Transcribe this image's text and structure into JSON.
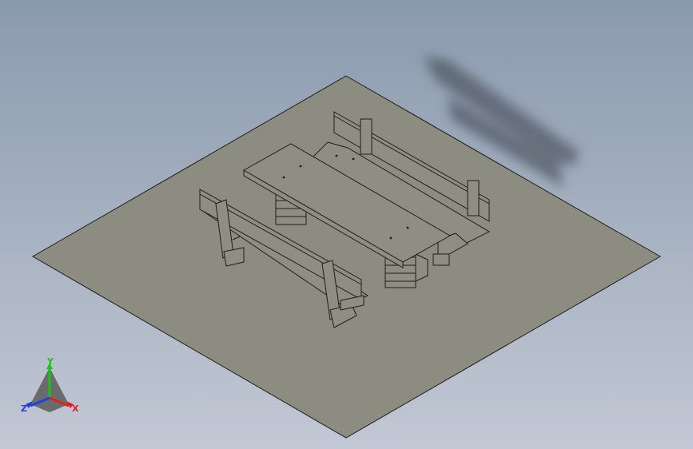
{
  "viewport": {
    "background_top": "#8a9aae",
    "background_bottom": "#c2c8d4"
  },
  "scene": {
    "model": "picnic-table-with-benches",
    "ground_color": "#8c8c80",
    "part_color": "#8e8e82",
    "edge_color": "#1e1e1e",
    "shadow_color": "#3a3f48"
  },
  "triad": {
    "x_label": "X",
    "y_label": "Y",
    "z_label": "Z",
    "x_color": "#e02020",
    "y_color": "#1fbf1f",
    "z_color": "#2040e0"
  }
}
